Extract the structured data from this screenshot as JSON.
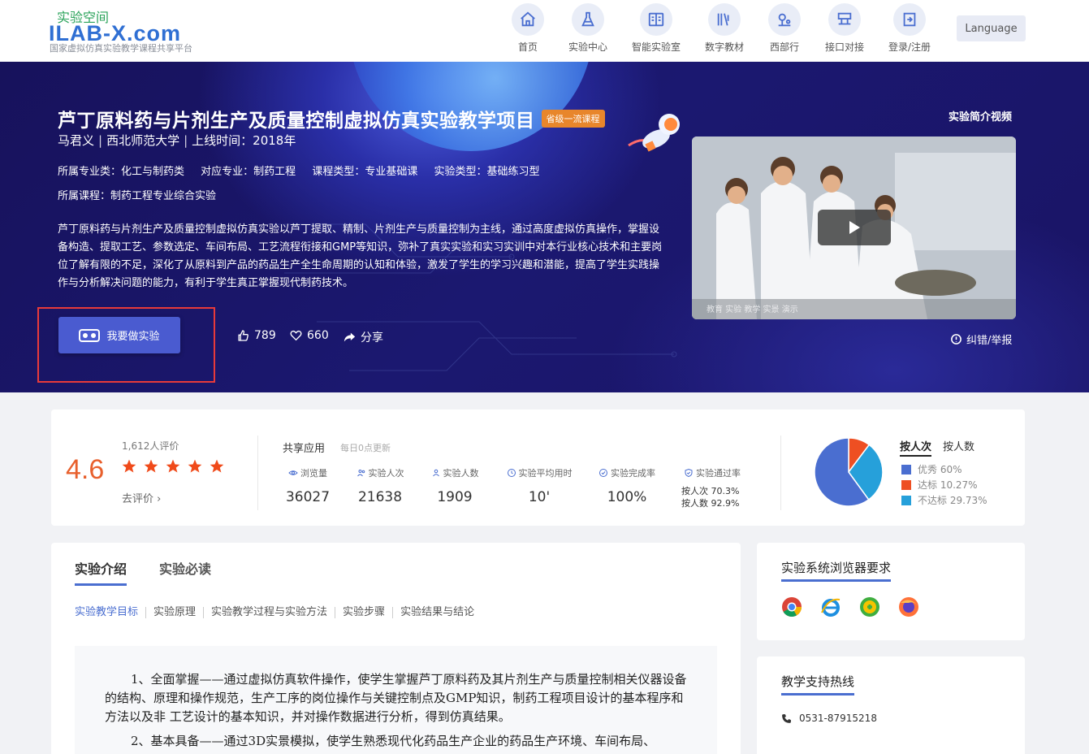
{
  "header": {
    "logo_cn": "实验空间",
    "logo_main": "ILAB-X.com",
    "logo_sub": "国家虚拟仿真实验教学课程共享平台",
    "nav": [
      {
        "label": "首页",
        "icon": "home-icon"
      },
      {
        "label": "实验中心",
        "icon": "flask-icon"
      },
      {
        "label": "智能实验室",
        "icon": "lab-book-icon"
      },
      {
        "label": "数字教材",
        "icon": "books-vr-icon"
      },
      {
        "label": "西部行",
        "icon": "location-icon"
      },
      {
        "label": "接口对接",
        "icon": "interface-icon"
      },
      {
        "label": "登录/注册",
        "icon": "login-icon"
      }
    ],
    "language": "Language"
  },
  "hero": {
    "title": "芦丁原料药与片剂生产及质量控制虚拟仿真实验教学项目",
    "badge": "省级一流课程",
    "author": "马君义",
    "school": "西北师范大学",
    "online": "上线时间：2018年",
    "tags": [
      "所属专业类：化工与制药类",
      "对应专业：制药工程",
      "课程类型：专业基础课",
      "实验类型：基础练习型"
    ],
    "course": "所属课程：制药工程专业综合实验",
    "description": "芦丁原料药与片剂生产及质量控制虚拟仿真实验以芦丁提取、精制、片剂生产与质量控制为主线，通过高度虚拟仿真操作，掌握设备构造、提取工艺、参数选定、车间布局、工艺流程衔接和GMP等知识，弥补了真实实验和实习实训中对本行业核心技术和主要岗位了解有限的不足，深化了从原料到产品的药品生产全生命周期的认知和体验，激发了学生的学习兴趣和潜能，提高了学生实践操作与分析解决问题的能力，有利于学生真正掌握现代制药技术。",
    "do_button": "我要做实验",
    "likes": "789",
    "favorites": "660",
    "share": "分享",
    "video_label": "实验简介视频",
    "video_caption": "教育 实验 教学 实景 演示",
    "report": "纠错/举报"
  },
  "stats": {
    "rating": "4.6",
    "rating_count": "1,612人评价",
    "stars": 5,
    "go_rate": "去评价",
    "share_title": "共享应用",
    "share_sub": "每日0点更新",
    "metrics": [
      {
        "label": "浏览量",
        "value": "36027",
        "icon": "eye-icon"
      },
      {
        "label": "实验人次",
        "value": "21638",
        "icon": "users-icon"
      },
      {
        "label": "实验人数",
        "value": "1909",
        "icon": "user-icon"
      },
      {
        "label": "实验平均用时",
        "value": "10'",
        "icon": "clock-icon"
      },
      {
        "label": "实验完成率",
        "value": "100%",
        "icon": "check-circle-icon"
      },
      {
        "label": "实验通过率",
        "value": "",
        "icon": "shield-icon"
      }
    ],
    "pass_by_times": "按人次 70.3%",
    "pass_by_people": "按人数 92.9%",
    "pie_tabs": [
      "按人次",
      "按人数"
    ],
    "legend": [
      {
        "label": "优秀 60%",
        "color": "#4a6ed0"
      },
      {
        "label": "达标 10.27%",
        "color": "#ee4f22"
      },
      {
        "label": "不达标 29.73%",
        "color": "#26a0da"
      }
    ]
  },
  "chart_data": {
    "type": "pie",
    "categories": [
      "优秀",
      "达标",
      "不达标"
    ],
    "values": [
      60,
      10.27,
      29.73
    ],
    "colors": [
      "#4a6ed0",
      "#ee4f22",
      "#26a0da"
    ]
  },
  "main": {
    "tabs": [
      "实验介绍",
      "实验必读"
    ],
    "subtabs": [
      "实验教学目标",
      "实验原理",
      "实验教学过程与实验方法",
      "实验步骤",
      "实验结果与结论"
    ],
    "p1": "1、全面掌握——通过虚拟仿真软件操作，使学生掌握芦丁原料药及其片剂生产与质量控制相关仪器设备的结构、原理和操作规范，生产工序的岗位操作与关键控制点及GMP知识，制药工程项目设计的基本程序和方法以及非 工艺设计的基本知识，并对操作数据进行分析，得到仿真结果。",
    "p2": "2、基本具备——通过3D实景模拟，使学生熟悉现代化药品生产企业的药品生产环境、车间布局、"
  },
  "side": {
    "browser_title": "实验系统浏览器要求",
    "browsers": [
      "chrome-icon",
      "ie-icon",
      "360-browser-icon",
      "firefox-icon"
    ],
    "hotline_title": "教学支持热线",
    "hotline": "0531-87915218"
  }
}
